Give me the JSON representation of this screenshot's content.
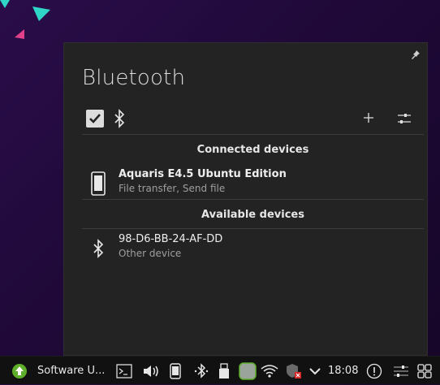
{
  "popup": {
    "title": "Bluetooth",
    "sections": {
      "connected": "Connected devices",
      "available": "Available devices"
    },
    "connected_devices": [
      {
        "name": "Aquaris E4.5 Ubuntu Edition",
        "detail": "File transfer, Send file",
        "icon": "phone-icon"
      }
    ],
    "available_devices": [
      {
        "name": "98-D6-BB-24-AF-DD",
        "detail": "Other device",
        "icon": "bluetooth-icon"
      }
    ]
  },
  "taskbar": {
    "task_label": "Software U...",
    "clock": "18:08"
  },
  "colors": {
    "panel_bg": "#232323",
    "taskbar_bg": "#111111",
    "wallpaper": "#1f0938",
    "accent_green": "#5fae2a"
  }
}
